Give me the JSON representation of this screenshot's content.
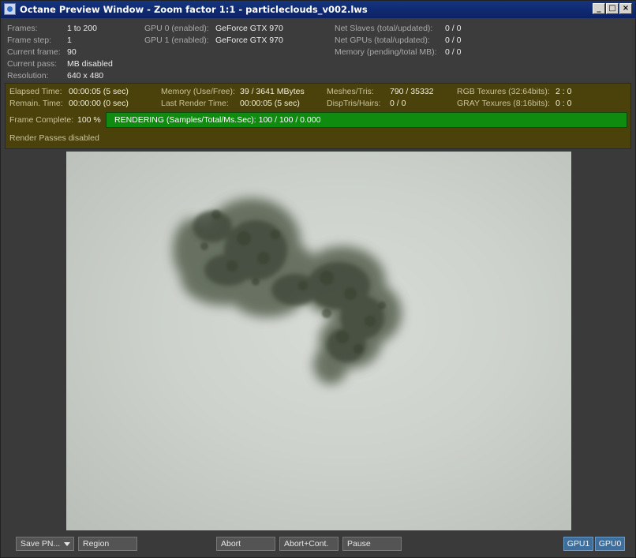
{
  "titlebar": {
    "title": "Octane Preview Window - Zoom factor 1:1 - particleclouds_v002.lws",
    "minimize": "_",
    "maximize": "□",
    "close": "×"
  },
  "info": {
    "frames_label": "Frames:",
    "frames_value": "1 to 200",
    "frame_step_label": "Frame step:",
    "frame_step_value": "1",
    "current_frame_label": "Current frame:",
    "current_frame_value": "90",
    "current_pass_label": "Current pass:",
    "current_pass_value": "MB disabled",
    "resolution_label": "Resolution:",
    "resolution_value": "640 x 480",
    "gpu0_label": "GPU  0 (enabled):",
    "gpu0_value": "GeForce GTX 970",
    "gpu1_label": "GPU  1 (enabled):",
    "gpu1_value": "GeForce GTX 970",
    "net_slaves_label": "Net Slaves (total/updated):",
    "net_slaves_value": "0 / 0",
    "net_gpus_label": "Net GPUs (total/updated):",
    "net_gpus_value": "0 / 0",
    "memory_label": "Memory (pending/total MB):",
    "memory_value": "0 / 0"
  },
  "stats": {
    "elapsed_label": "Elapsed Time:",
    "elapsed_value": "00:00:05 (5 sec)",
    "remain_label": "Remain. Time:",
    "remain_value": "00:00:00 (0 sec)",
    "mem_use_label": "Memory (Use/Free):",
    "mem_use_value": "39 / 3641 MBytes",
    "last_render_label": "Last Render Time:",
    "last_render_value": "00:00:05 (5 sec)",
    "meshes_label": "Meshes/Tris:",
    "meshes_value": "790 / 35332",
    "disp_label": "DispTris/Hairs:",
    "disp_value": "0 / 0",
    "rgb_label": "RGB Texures (32:64bits):",
    "rgb_value": "2 : 0",
    "gray_label": "GRAY Texures (8:16bits):",
    "gray_value": "0 : 0",
    "frame_complete_label": "Frame Complete:",
    "frame_complete_value": "100 %",
    "frame_complete_fraction": 1.0,
    "rendering_text": "RENDERING (Samples/Total/Ms.Sec): 100 / 100 / 0.000",
    "render_passes": "Render Passes disabled"
  },
  "buttons": {
    "save": "Save PN...",
    "region": "Region",
    "abort": "Abort",
    "abort_cont": "Abort+Cont.",
    "pause": "Pause",
    "gpu1": "GPU1",
    "gpu0": "GPU0"
  },
  "colors": {
    "titlebar": "#0b2266",
    "stats_panel": "#4b410b",
    "progress": "#0f8c0f",
    "gpu_button": "#3d6e9c"
  }
}
